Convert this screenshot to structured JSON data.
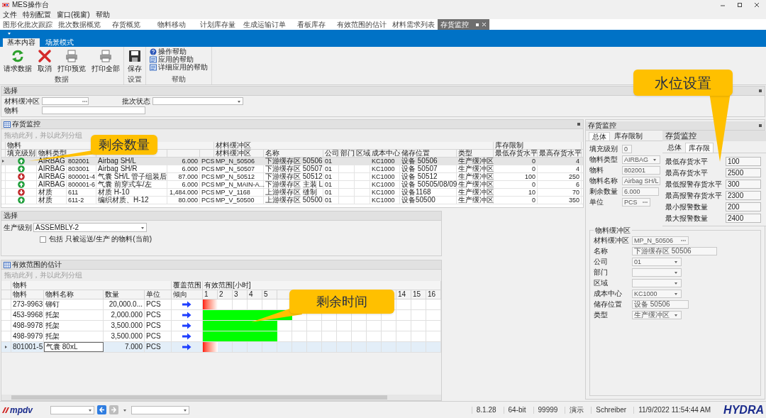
{
  "window": {
    "title": "MES操作台"
  },
  "menu": [
    "文件",
    "特别配置",
    "窗口(视窗)",
    "帮助"
  ],
  "document_tabs": [
    {
      "label": "图形化批次跟踪",
      "selected": false
    },
    {
      "label": "批次数据概览",
      "selected": false
    },
    {
      "label": "存货概览",
      "selected": false
    },
    {
      "label": "物料移动",
      "selected": false
    },
    {
      "label": "计划库存量",
      "selected": false
    },
    {
      "label": "生成运输订单",
      "selected": false
    },
    {
      "label": "看板库存",
      "selected": false
    },
    {
      "label": "有效范围的估计",
      "selected": false
    },
    {
      "label": "材料需求列表",
      "selected": false
    },
    {
      "label": "存货监控",
      "selected": true
    }
  ],
  "ribbon": {
    "tabs": [
      {
        "label": "基本内容",
        "selected": true
      },
      {
        "label": "场景模式",
        "selected": false
      }
    ],
    "groups": [
      {
        "label": "数据",
        "buttons": [
          {
            "label": "请求数据",
            "kind": "refresh"
          },
          {
            "label": "取消",
            "kind": "cancel"
          },
          {
            "label": "打印预览",
            "kind": "print"
          },
          {
            "label": "打印全部",
            "kind": "print"
          }
        ]
      },
      {
        "label": "设置",
        "buttons": [
          {
            "label": "保存",
            "kind": "save"
          }
        ]
      },
      {
        "label": "帮助",
        "buttons": [
          {
            "label": "操作帮助",
            "kind": "help"
          },
          {
            "label": "应用的帮助",
            "kind": "doc"
          },
          {
            "label": "详细应用的帮助",
            "kind": "doc"
          }
        ]
      }
    ]
  },
  "selection": {
    "title": "选择",
    "fields": [
      {
        "label": "材料缓冲区",
        "kind": "lookup"
      },
      {
        "label": "批次状态",
        "kind": "dropdown"
      },
      {
        "label": "物料",
        "kind": "text"
      }
    ]
  },
  "inventory_monitor": {
    "title": "存货监控",
    "group_hint": "拖动此列，并以此列分组",
    "column_groups": [
      "物料",
      "材料缓冲区",
      "库存限制"
    ],
    "columns": [
      "填充级别",
      "物料类型",
      "材料缓冲区",
      "名称",
      "公司",
      "部门",
      "区域",
      "成本中心",
      "储存位置",
      "类型",
      "最低存货水平",
      "最高存货水平"
    ],
    "rows": [
      {
        "selected": true,
        "kind": "ok",
        "type": "AIRBAG",
        "material": "802001",
        "name": "Airbag SH/L",
        "qty": "6.000",
        "unit": "PCS",
        "buffer": "MP_N_50506",
        "buffer_name": "下游缓存区 50506",
        "company": "01",
        "cost_center": "KC1000",
        "location": "设备 50506",
        "buffer_type": "生产缓冲区",
        "min": "0",
        "max": "4"
      },
      {
        "selected": false,
        "kind": "ok",
        "type": "AIRBAG",
        "material": "803001",
        "name": "Airbag SH/R",
        "qty": "6.000",
        "unit": "PCS",
        "buffer": "MP_N_50507",
        "buffer_name": "下游缓存区 50507",
        "company": "01",
        "cost_center": "KC1000",
        "location": "设备 50507",
        "buffer_type": "生产缓冲区",
        "min": "0",
        "max": "4"
      },
      {
        "selected": false,
        "kind": "alert",
        "type": "AIRBAG",
        "material": "800001-4",
        "name": "气囊 SH/L 管子组装后",
        "qty": "87.000",
        "unit": "PCS",
        "buffer": "MP_N_50512",
        "buffer_name": "下游缓存区 50512",
        "company": "01",
        "cost_center": "KC1000",
        "location": "设备 50512",
        "buffer_type": "生产缓冲区",
        "min": "100",
        "max": "250"
      },
      {
        "selected": false,
        "kind": "ok",
        "type": "AIRBAG",
        "material": "800001-6",
        "name": "气囊 前穿式车/左",
        "qty": "6.000",
        "unit": "PCS",
        "buffer": "MP_N_MAIN-A...",
        "buffer_name": "下游缓存区 主装 L",
        "company": "01",
        "cost_center": "KC1000",
        "location": "设备 50505/08/09",
        "buffer_type": "生产缓冲区",
        "min": "0",
        "max": "6"
      },
      {
        "selected": false,
        "kind": "alert",
        "type": "材质",
        "material": "611",
        "name": "材质 H-10",
        "qty": "1,484.000",
        "unit": "PCS",
        "buffer": "MP_V_1168",
        "buffer_name": "上游缓存区 缝制",
        "company": "01",
        "cost_center": "KC1000",
        "location": "设备1168",
        "buffer_type": "生产缓冲区",
        "min": "10",
        "max": "70"
      },
      {
        "selected": false,
        "kind": "ok",
        "type": "材质",
        "material": "611-2",
        "name": "编织材质、H-12",
        "qty": "80.000",
        "unit": "PCS",
        "buffer": "MP_V_50500",
        "buffer_name": "上游缓存区 50500",
        "company": "01",
        "cost_center": "KC1000",
        "location": "设备50500",
        "buffer_type": "生产缓冲区",
        "min": "0",
        "max": "350"
      }
    ]
  },
  "production_selection": {
    "title": "选择",
    "level_label": "生产级别",
    "level_value": "ASSEMBLY-2",
    "checkbox": {
      "label": "包括 只被运送/生产 的物料(当前)",
      "checked": false
    }
  },
  "range_estimate": {
    "title": "有效范围的估计",
    "group_hint": "拖动此列，并以此列分组",
    "column_groups": [
      "物料",
      "覆盖范围",
      "有效范围[小时]"
    ],
    "columns": [
      "物料",
      "物料名称",
      "数量",
      "单位",
      "倾向"
    ],
    "hours": [
      "1",
      "2",
      "3",
      "4",
      "5",
      "14",
      "15",
      "16"
    ],
    "rows": [
      {
        "material": "273-9963",
        "name": "铆钉",
        "qty": "20,000.0...",
        "unit": "PCS",
        "selected": false,
        "kind": "critical",
        "level": 0.0625
      },
      {
        "material": "453-9968",
        "name": "托架",
        "qty": "2,000.000",
        "unit": "PCS",
        "selected": false,
        "kind": "ok",
        "level": 0.375
      },
      {
        "material": "498-9978",
        "name": "托架",
        "qty": "3,500.000",
        "unit": "PCS",
        "selected": false,
        "kind": "ok",
        "level": 0.3125
      },
      {
        "material": "498-9979",
        "name": "托架",
        "qty": "3,500.000",
        "unit": "PCS",
        "selected": false,
        "kind": "ok",
        "level": 0.3125
      },
      {
        "material": "801001-5",
        "name": "气囊 80xL",
        "qty": "7.000",
        "unit": "PCS",
        "selected": true,
        "kind": "critical",
        "level": 0.0625
      }
    ]
  },
  "detail": {
    "title": "存货监控",
    "tabs": [
      {
        "label": "总体",
        "selected": true
      },
      {
        "label": "库存限制",
        "selected": false
      }
    ],
    "fields": [
      {
        "label": "填充级别",
        "value": "0",
        "kind": "small"
      },
      {
        "label": "物料类型",
        "value": "AIRBAG",
        "kind": "dropdown"
      },
      {
        "label": "物料",
        "value": "802001",
        "kind": "text"
      },
      {
        "label": "物料名称",
        "value": "Airbag SH/L",
        "kind": "text"
      },
      {
        "label": "剩余数量",
        "value": "6.000",
        "kind": "medium"
      },
      {
        "label": "单位",
        "value": "PCS",
        "kind": "lookup"
      }
    ],
    "group": {
      "title": "物料缓冲区",
      "fields": [
        {
          "label": "材料缓冲区",
          "value": "MP_N_50506",
          "kind": "lookup"
        },
        {
          "label": "名称",
          "value": "下游缓存区 50506",
          "kind": "text"
        },
        {
          "label": "公司",
          "value": "01",
          "kind": "dropdown"
        },
        {
          "label": "部门",
          "kind": "dropdown"
        },
        {
          "label": "区域",
          "kind": "dropdown"
        },
        {
          "label": "成本中心",
          "value": "KC1000",
          "kind": "dropdown"
        },
        {
          "label": "储存位置",
          "value": "设备 50506",
          "kind": "medium"
        },
        {
          "label": "类型",
          "value": "生产缓冲区",
          "kind": "dropdown"
        }
      ]
    }
  },
  "limits_inset": {
    "title": "存货监控",
    "tabs": [
      {
        "label": "总体",
        "selected": false
      },
      {
        "label": "库存限",
        "selected": true
      }
    ],
    "fields": [
      {
        "label": "最低存货水平",
        "value": "100"
      },
      {
        "label": "最高存货水平",
        "value": "2500"
      },
      {
        "label": "最低报警存货水平",
        "value": "300"
      },
      {
        "label": "最高报警存货水平",
        "value": "2300"
      },
      {
        "label": "最小报警数量",
        "value": "200"
      },
      {
        "label": "最大报警数量",
        "value": "2400"
      }
    ]
  },
  "annotations": [
    {
      "text": "剩余数量"
    },
    {
      "text": "剩余时间"
    },
    {
      "text": "水位设置"
    }
  ],
  "status_bar": {
    "logo": "mpdv",
    "items": [
      "8.1.28",
      "64-bit",
      "99999",
      "演示",
      "Schreiber",
      "11/9/2022 11:54:44 AM"
    ],
    "brand": "HYDRA"
  }
}
